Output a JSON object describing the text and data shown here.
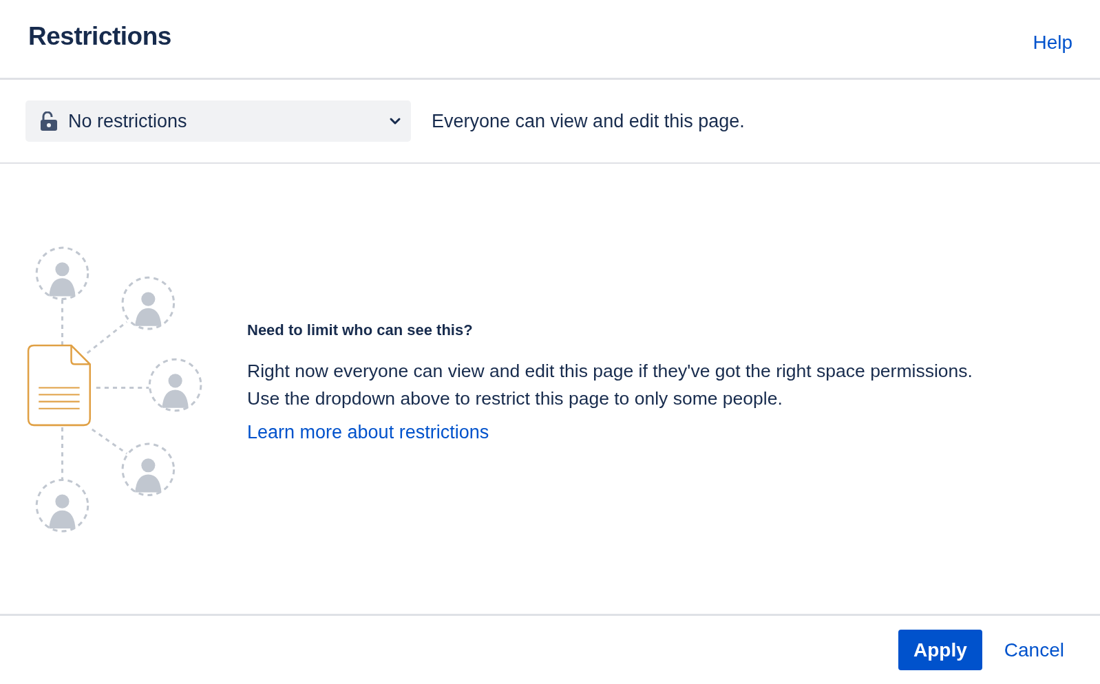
{
  "dialog": {
    "title": "Restrictions",
    "help_link": "Help"
  },
  "restriction_select": {
    "value": "No restrictions"
  },
  "restriction_description": "Everyone can view and edit this page.",
  "info": {
    "heading": "Need to limit who can see this?",
    "body": "Right now everyone can view and edit this page if they've got the right space permissions. Use the dropdown above to restrict this page to only some people.",
    "link": "Learn more about restrictions"
  },
  "buttons": [
    {
      "label": "Apply",
      "kind": "primary"
    },
    {
      "label": "Cancel",
      "kind": "link"
    }
  ]
}
